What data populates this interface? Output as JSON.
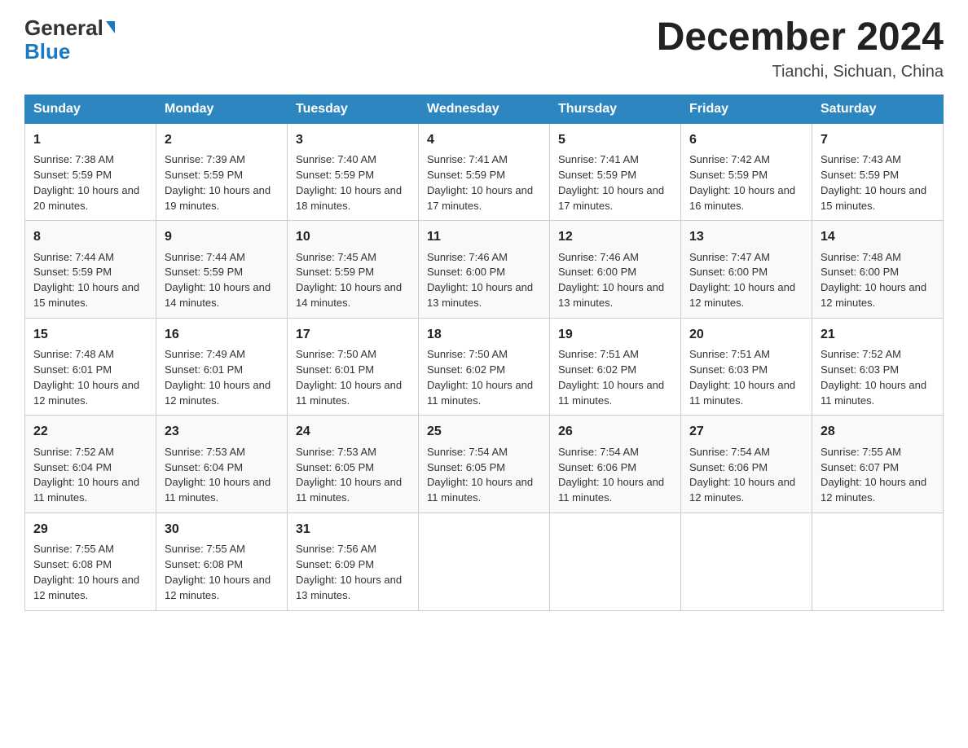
{
  "logo": {
    "general": "General",
    "blue": "Blue",
    "triangle": "▶"
  },
  "title": "December 2024",
  "location": "Tianchi, Sichuan, China",
  "days": [
    "Sunday",
    "Monday",
    "Tuesday",
    "Wednesday",
    "Thursday",
    "Friday",
    "Saturday"
  ],
  "weeks": [
    [
      {
        "num": "1",
        "sunrise": "7:38 AM",
        "sunset": "5:59 PM",
        "daylight": "10 hours and 20 minutes."
      },
      {
        "num": "2",
        "sunrise": "7:39 AM",
        "sunset": "5:59 PM",
        "daylight": "10 hours and 19 minutes."
      },
      {
        "num": "3",
        "sunrise": "7:40 AM",
        "sunset": "5:59 PM",
        "daylight": "10 hours and 18 minutes."
      },
      {
        "num": "4",
        "sunrise": "7:41 AM",
        "sunset": "5:59 PM",
        "daylight": "10 hours and 17 minutes."
      },
      {
        "num": "5",
        "sunrise": "7:41 AM",
        "sunset": "5:59 PM",
        "daylight": "10 hours and 17 minutes."
      },
      {
        "num": "6",
        "sunrise": "7:42 AM",
        "sunset": "5:59 PM",
        "daylight": "10 hours and 16 minutes."
      },
      {
        "num": "7",
        "sunrise": "7:43 AM",
        "sunset": "5:59 PM",
        "daylight": "10 hours and 15 minutes."
      }
    ],
    [
      {
        "num": "8",
        "sunrise": "7:44 AM",
        "sunset": "5:59 PM",
        "daylight": "10 hours and 15 minutes."
      },
      {
        "num": "9",
        "sunrise": "7:44 AM",
        "sunset": "5:59 PM",
        "daylight": "10 hours and 14 minutes."
      },
      {
        "num": "10",
        "sunrise": "7:45 AM",
        "sunset": "5:59 PM",
        "daylight": "10 hours and 14 minutes."
      },
      {
        "num": "11",
        "sunrise": "7:46 AM",
        "sunset": "6:00 PM",
        "daylight": "10 hours and 13 minutes."
      },
      {
        "num": "12",
        "sunrise": "7:46 AM",
        "sunset": "6:00 PM",
        "daylight": "10 hours and 13 minutes."
      },
      {
        "num": "13",
        "sunrise": "7:47 AM",
        "sunset": "6:00 PM",
        "daylight": "10 hours and 12 minutes."
      },
      {
        "num": "14",
        "sunrise": "7:48 AM",
        "sunset": "6:00 PM",
        "daylight": "10 hours and 12 minutes."
      }
    ],
    [
      {
        "num": "15",
        "sunrise": "7:48 AM",
        "sunset": "6:01 PM",
        "daylight": "10 hours and 12 minutes."
      },
      {
        "num": "16",
        "sunrise": "7:49 AM",
        "sunset": "6:01 PM",
        "daylight": "10 hours and 12 minutes."
      },
      {
        "num": "17",
        "sunrise": "7:50 AM",
        "sunset": "6:01 PM",
        "daylight": "10 hours and 11 minutes."
      },
      {
        "num": "18",
        "sunrise": "7:50 AM",
        "sunset": "6:02 PM",
        "daylight": "10 hours and 11 minutes."
      },
      {
        "num": "19",
        "sunrise": "7:51 AM",
        "sunset": "6:02 PM",
        "daylight": "10 hours and 11 minutes."
      },
      {
        "num": "20",
        "sunrise": "7:51 AM",
        "sunset": "6:03 PM",
        "daylight": "10 hours and 11 minutes."
      },
      {
        "num": "21",
        "sunrise": "7:52 AM",
        "sunset": "6:03 PM",
        "daylight": "10 hours and 11 minutes."
      }
    ],
    [
      {
        "num": "22",
        "sunrise": "7:52 AM",
        "sunset": "6:04 PM",
        "daylight": "10 hours and 11 minutes."
      },
      {
        "num": "23",
        "sunrise": "7:53 AM",
        "sunset": "6:04 PM",
        "daylight": "10 hours and 11 minutes."
      },
      {
        "num": "24",
        "sunrise": "7:53 AM",
        "sunset": "6:05 PM",
        "daylight": "10 hours and 11 minutes."
      },
      {
        "num": "25",
        "sunrise": "7:54 AM",
        "sunset": "6:05 PM",
        "daylight": "10 hours and 11 minutes."
      },
      {
        "num": "26",
        "sunrise": "7:54 AM",
        "sunset": "6:06 PM",
        "daylight": "10 hours and 11 minutes."
      },
      {
        "num": "27",
        "sunrise": "7:54 AM",
        "sunset": "6:06 PM",
        "daylight": "10 hours and 12 minutes."
      },
      {
        "num": "28",
        "sunrise": "7:55 AM",
        "sunset": "6:07 PM",
        "daylight": "10 hours and 12 minutes."
      }
    ],
    [
      {
        "num": "29",
        "sunrise": "7:55 AM",
        "sunset": "6:08 PM",
        "daylight": "10 hours and 12 minutes."
      },
      {
        "num": "30",
        "sunrise": "7:55 AM",
        "sunset": "6:08 PM",
        "daylight": "10 hours and 12 minutes."
      },
      {
        "num": "31",
        "sunrise": "7:56 AM",
        "sunset": "6:09 PM",
        "daylight": "10 hours and 13 minutes."
      },
      null,
      null,
      null,
      null
    ]
  ],
  "labels": {
    "sunrise_prefix": "Sunrise: ",
    "sunset_prefix": "Sunset: ",
    "daylight_prefix": "Daylight: "
  }
}
